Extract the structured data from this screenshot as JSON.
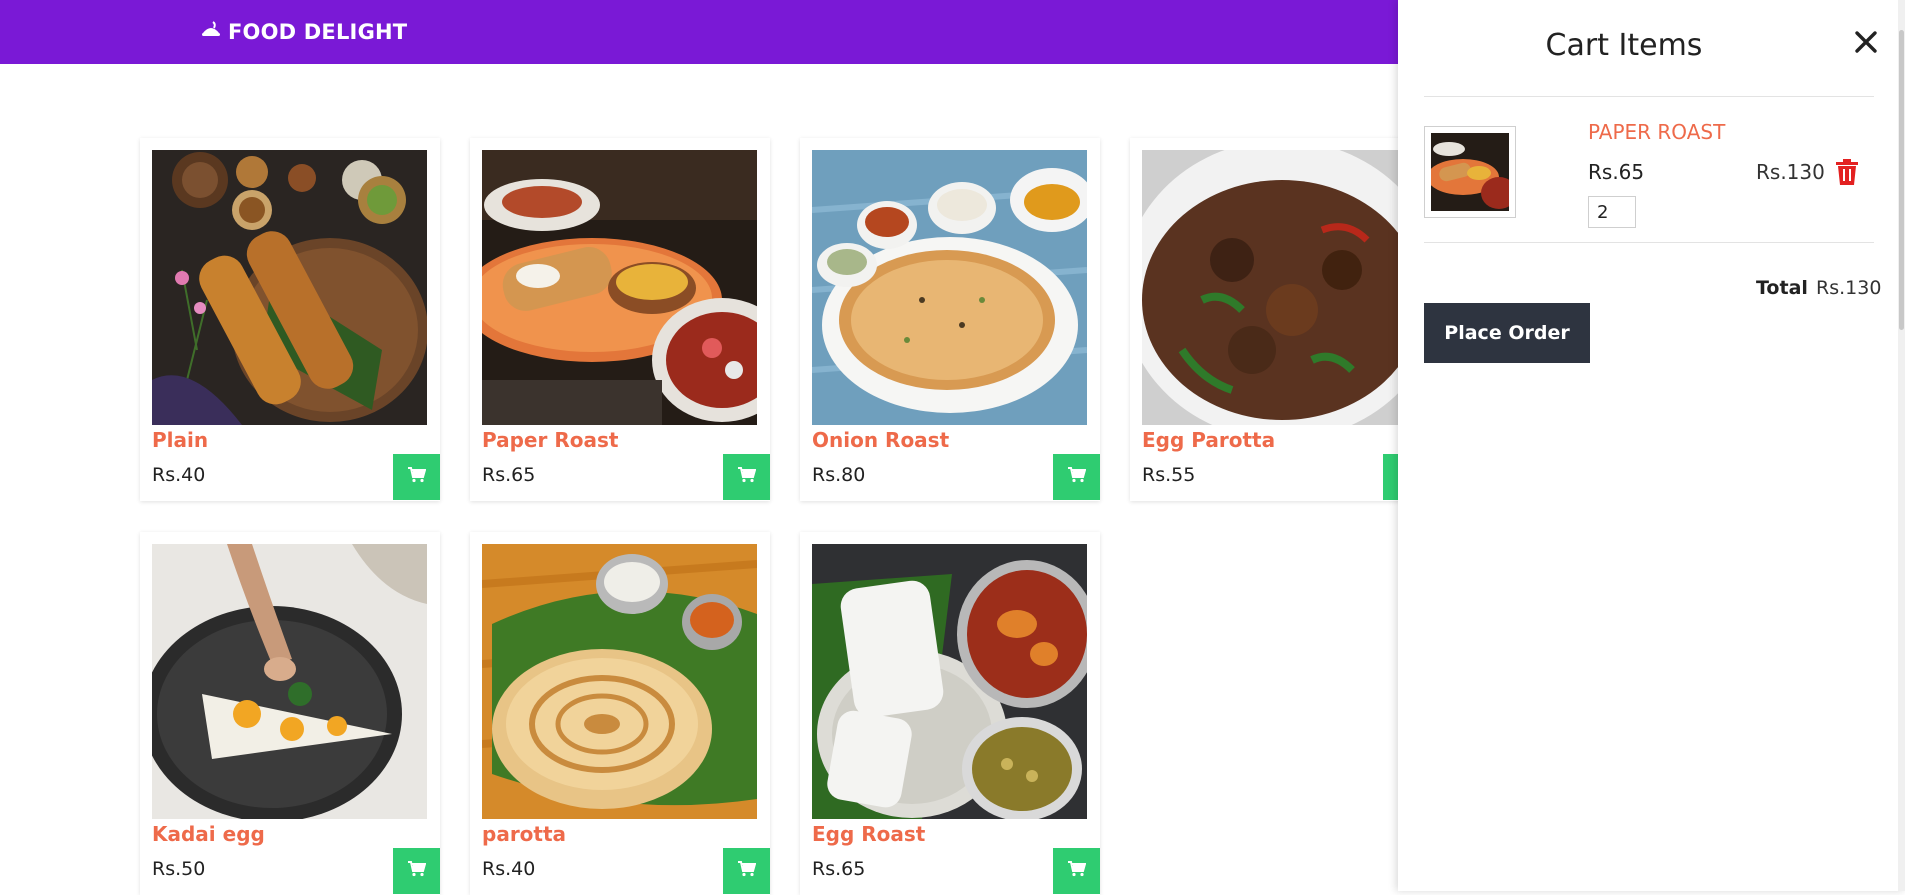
{
  "navbar": {
    "brand": "FOOD DELIGHT",
    "brand_icon": "food-plate-icon",
    "background": "#7a19d6"
  },
  "menu": {
    "items": [
      {
        "name": "Plain",
        "price": "Rs.40",
        "image": "dosa-plate"
      },
      {
        "name": "Paper Roast",
        "price": "Rs.65",
        "image": "paper-roast-dish"
      },
      {
        "name": "Onion Roast",
        "price": "Rs.80",
        "image": "onion-uttapam"
      },
      {
        "name": "Egg Parotta",
        "price": "Rs.55",
        "image": "egg-parotta-bowl"
      },
      {
        "name": "Kadai egg",
        "price": "Rs.50",
        "image": "kadai-egg"
      },
      {
        "name": "parotta",
        "price": "Rs.40",
        "image": "parotta-on-leaf"
      },
      {
        "name": "Egg Roast",
        "price": "Rs.65",
        "image": "puttu-egg-roast"
      }
    ],
    "add_button_icon": "cart-icon",
    "name_color": "#ee6a4a",
    "button_color": "#2fcc71"
  },
  "cart": {
    "title": "Cart Items",
    "close_icon": "close-icon",
    "items": [
      {
        "name": "PAPER ROAST",
        "price": "Rs.65",
        "subtotal": "Rs.130",
        "quantity": "2"
      }
    ],
    "delete_icon": "trash-icon",
    "total_label": "Total",
    "total_value": "Rs.130",
    "place_order_label": "Place Order"
  }
}
